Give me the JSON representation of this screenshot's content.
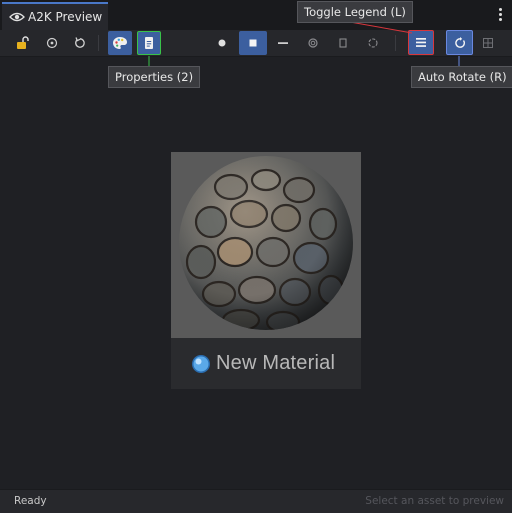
{
  "window": {
    "tab_title": "A2K Preview"
  },
  "toolbar": {
    "buttons": [
      {
        "id": "lock",
        "icon": "lock-open-icon",
        "active": false
      },
      {
        "id": "target",
        "icon": "target-icon",
        "active": false
      },
      {
        "id": "reset",
        "icon": "reset-icon",
        "active": false
      },
      {
        "id": "palette",
        "icon": "palette-icon",
        "active": true
      },
      {
        "id": "properties",
        "icon": "document-icon",
        "active": true,
        "highlight": "green"
      },
      {
        "id": "sphere",
        "icon": "sphere-shape-icon",
        "active": false
      },
      {
        "id": "cube",
        "icon": "cube-shape-icon",
        "active": true
      },
      {
        "id": "plane",
        "icon": "plane-shape-icon",
        "active": false
      },
      {
        "id": "torus",
        "icon": "torus-shape-icon",
        "active": false
      },
      {
        "id": "cylinder",
        "icon": "cylinder-shape-icon",
        "active": false
      },
      {
        "id": "capsule",
        "icon": "capsule-shape-icon",
        "active": false
      },
      {
        "id": "legend",
        "icon": "legend-icon",
        "active": true,
        "highlight": "red"
      },
      {
        "id": "auto_rotate",
        "icon": "auto-rotate-icon",
        "active": true,
        "highlight": "blue"
      },
      {
        "id": "grid",
        "icon": "grid-icon",
        "active": false
      }
    ]
  },
  "tooltips": {
    "properties": "Properties (2)",
    "legend": "Toggle Legend (L)",
    "auto_rotate": "Auto Rotate (R)"
  },
  "preview": {
    "material_name": "New Material"
  },
  "status": {
    "left": "Ready",
    "right": "Select an asset to preview"
  },
  "colors": {
    "accent": "#3c5f9f",
    "tab_indicator": "#4a78c8",
    "highlight_green": "#39c24a",
    "highlight_red": "#d8363c",
    "highlight_blue": "#6a88e0",
    "background": "#1f2024"
  }
}
